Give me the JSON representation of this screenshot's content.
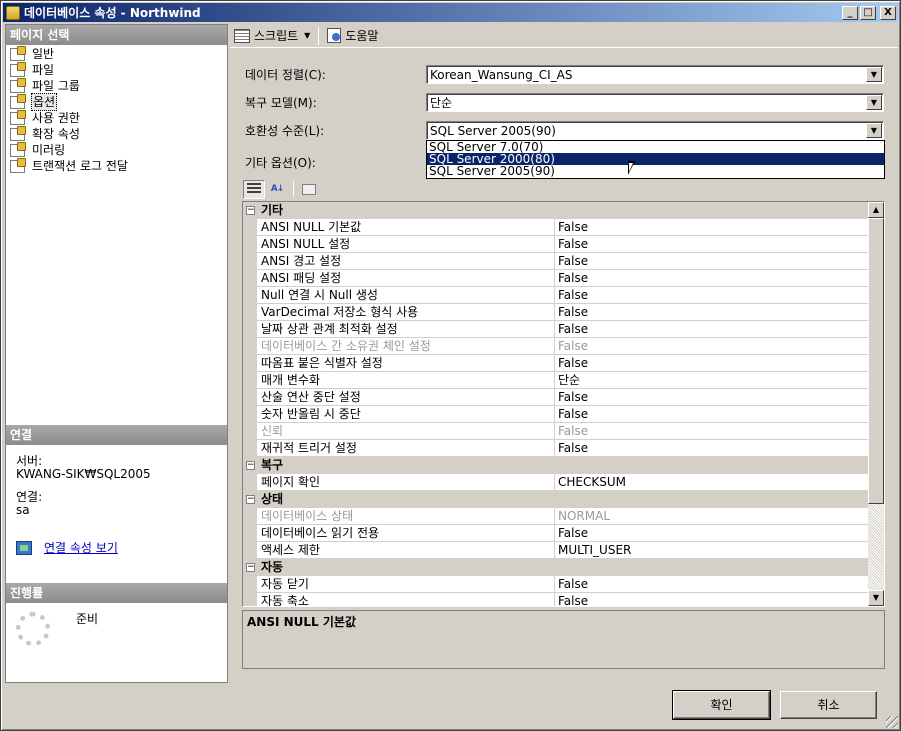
{
  "window": {
    "title": "데이터베이스 속성 - Northwind",
    "controls": {
      "minimize": "_",
      "maximize": "□",
      "close": "X"
    }
  },
  "left_pane": {
    "page_select_header": "페이지 선택",
    "pages": [
      {
        "label": "일반",
        "icon": "page-icon",
        "selected": false
      },
      {
        "label": "파일",
        "icon": "page-icon",
        "selected": false
      },
      {
        "label": "파일 그룹",
        "icon": "page-icon",
        "selected": false
      },
      {
        "label": "옵션",
        "icon": "page-icon",
        "selected": true
      },
      {
        "label": "사용 권한",
        "icon": "page-icon",
        "selected": false
      },
      {
        "label": "확장 속성",
        "icon": "page-icon",
        "selected": false
      },
      {
        "label": "미러링",
        "icon": "page-icon",
        "selected": false
      },
      {
        "label": "트랜잭션 로그 전달",
        "icon": "page-icon",
        "selected": false
      }
    ],
    "connection_header": "연결",
    "server_label": "서버:",
    "server_value": "KWANG-SIK₩SQL2005",
    "connection_label": "연결:",
    "connection_value": "sa",
    "view_connection_link": "연결 속성 보기",
    "progress_header": "진행률",
    "progress_status": "준비"
  },
  "toolbar": {
    "script_label": "스크립트",
    "help_label": "도움말"
  },
  "form": {
    "collation_label": "데이터 정렬(C):",
    "collation_value": "Korean_Wansung_CI_AS",
    "recovery_label": "복구 모델(M):",
    "recovery_value": "단순",
    "compat_label": "호환성 수준(L):",
    "compat_value": "SQL Server 2005(90)",
    "compat_options": [
      "SQL Server 7.0(70)",
      "SQL Server 2000(80)",
      "SQL Server 2005(90)"
    ],
    "compat_highlighted_index": 1,
    "other_options_label": "기타 옵션(O):"
  },
  "property_grid": {
    "categories": [
      {
        "name": "기타",
        "toggle": "⊟",
        "rows": [
          {
            "name": "ANSI NULL 기본값",
            "value": "False",
            "disabled": false
          },
          {
            "name": "ANSI NULL 설정",
            "value": "False",
            "disabled": false
          },
          {
            "name": "ANSI 경고 설정",
            "value": "False",
            "disabled": false
          },
          {
            "name": "ANSI 패딩 설정",
            "value": "False",
            "disabled": false
          },
          {
            "name": "Null 연결 시 Null 생성",
            "value": "False",
            "disabled": false
          },
          {
            "name": "VarDecimal 저장소 형식 사용",
            "value": "False",
            "disabled": false
          },
          {
            "name": "날짜 상관 관계 최적화 설정",
            "value": "False",
            "disabled": false
          },
          {
            "name": "데이터베이스 간 소유권 체인 설정",
            "value": "False",
            "disabled": true
          },
          {
            "name": "따옴표 붙은 식별자 설정",
            "value": "False",
            "disabled": false
          },
          {
            "name": "매개 변수화",
            "value": "단순",
            "disabled": false
          },
          {
            "name": "산술 연산 중단 설정",
            "value": "False",
            "disabled": false
          },
          {
            "name": "숫자 반올림 시 중단",
            "value": "False",
            "disabled": false
          },
          {
            "name": "신뢰",
            "value": "False",
            "disabled": true
          },
          {
            "name": "재귀적 트리거 설정",
            "value": "False",
            "disabled": false
          }
        ]
      },
      {
        "name": "복구",
        "toggle": "⊟",
        "rows": [
          {
            "name": "페이지 확인",
            "value": "CHECKSUM",
            "disabled": false
          }
        ]
      },
      {
        "name": "상태",
        "toggle": "⊟",
        "rows": [
          {
            "name": "데이터베이스 상태",
            "value": "NORMAL",
            "disabled": true
          },
          {
            "name": "데이터베이스 읽기 전용",
            "value": "False",
            "disabled": false
          },
          {
            "name": "액세스 제한",
            "value": "MULTI_USER",
            "disabled": false
          }
        ]
      },
      {
        "name": "자동",
        "toggle": "⊟",
        "rows": [
          {
            "name": "자동 닫기",
            "value": "False",
            "disabled": false
          },
          {
            "name": "자동 축소",
            "value": "False",
            "disabled": false
          }
        ]
      }
    ]
  },
  "description": "ANSI NULL 기본값",
  "buttons": {
    "ok": "확인",
    "cancel": "취소"
  },
  "colors": {
    "title_start": "#0a246a",
    "title_end": "#a6caf0",
    "selection": "#0a246a",
    "link": "#0000c0"
  }
}
